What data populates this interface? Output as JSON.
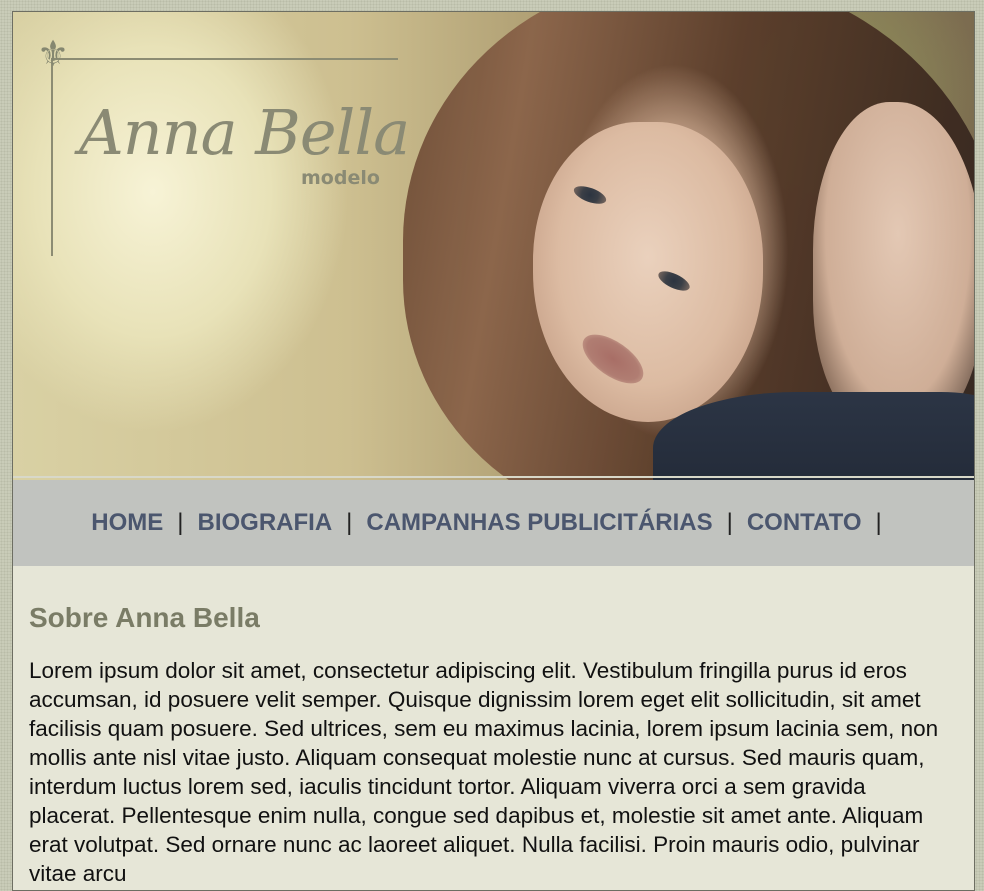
{
  "brand": {
    "name": "Anna Bella",
    "subtitle": "modelo"
  },
  "hero": {
    "image": "portrait-photo"
  },
  "nav": {
    "items": [
      {
        "label": "HOME"
      },
      {
        "label": "BIOGRAFIA"
      },
      {
        "label": "CAMPANHAS PUBLICITÁRIAS"
      },
      {
        "label": "CONTATO"
      }
    ],
    "separator": "|"
  },
  "main": {
    "heading": "Sobre Anna Bella",
    "body": "Lorem ipsum dolor sit amet, consectetur adipiscing elit. Vestibulum fringilla purus id eros accumsan, id posuere velit semper. Quisque dignissim lorem eget elit sollicitudin, sit amet facilisis quam posuere. Sed ultrices, sem eu maximus lacinia, lorem ipsum lacinia sem, non mollis ante nisl vitae justo. Aliquam consequat molestie nunc at cursus. Sed mauris quam, interdum luctus lorem sed, iaculis tincidunt tortor. Aliquam viverra orci a sem gravida placerat. Pellentesque enim nulla, congue sed dapibus et, molestie sit amet ante. Aliquam erat volutpat. Sed ornare nunc ac laoreet aliquet. Nulla facilisi. Proin mauris odio, pulvinar vitae arcu"
  },
  "colors": {
    "page_bg": "#e6e6d7",
    "nav_bg": "#c1c3bf",
    "nav_text": "#4b566e",
    "heading": "#7a7c66",
    "brand": "#8a8a74"
  }
}
